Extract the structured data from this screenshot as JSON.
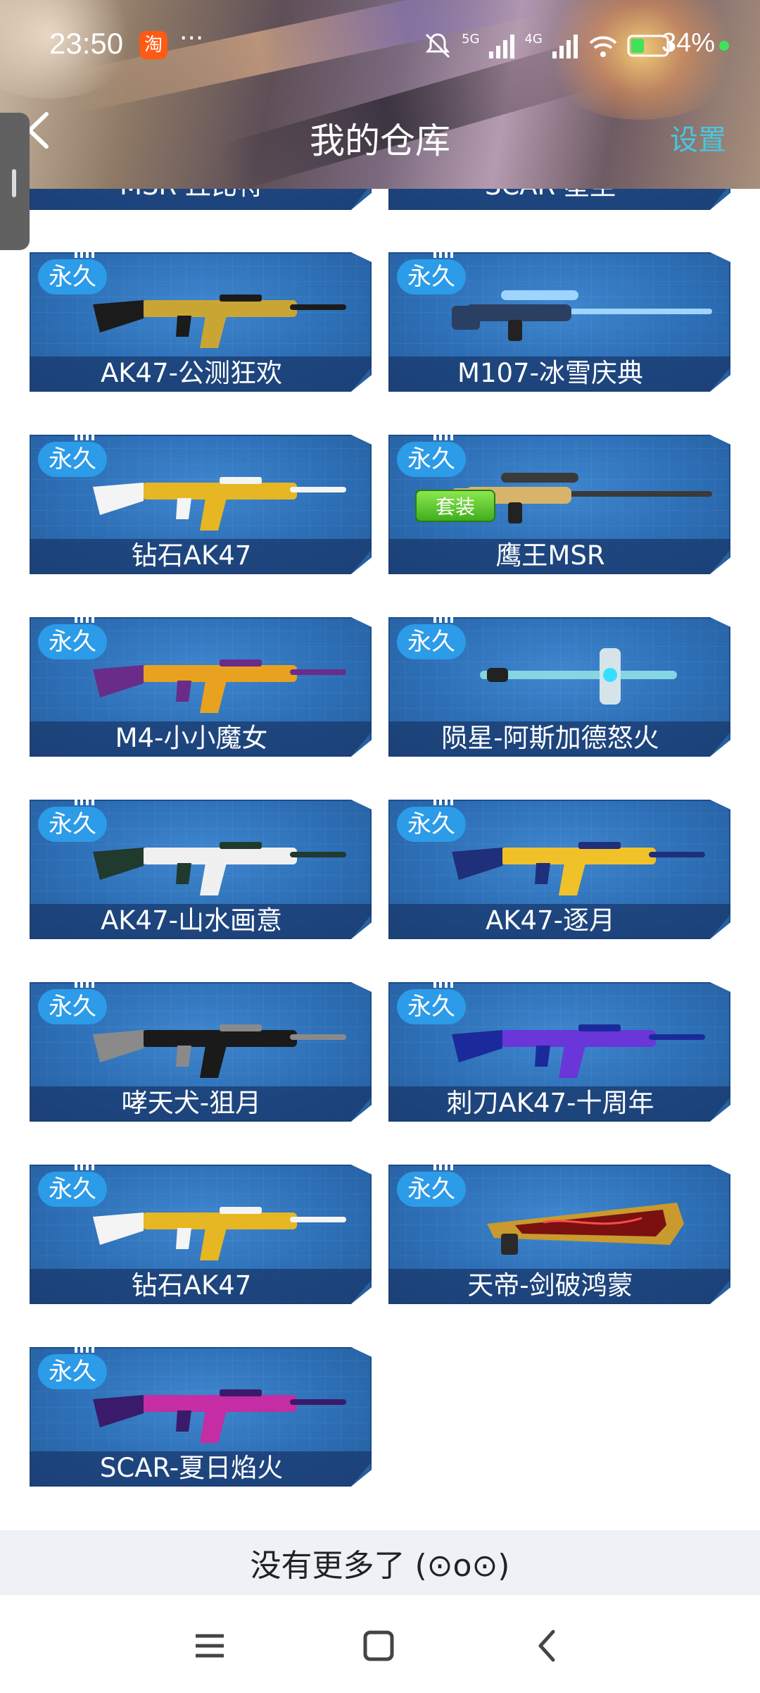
{
  "status_bar": {
    "time": "23:50",
    "app_badge": "淘",
    "more": "···",
    "network_5g": "5G",
    "network_4g": "4G",
    "battery": "34%"
  },
  "header": {
    "title": "我的仓库",
    "settings_label": "设置"
  },
  "top_cut_items": [
    {
      "name": "MSR-丘比特"
    },
    {
      "name": "SCAR-星尘"
    }
  ],
  "items": [
    {
      "name": "AK47-公测狂欢",
      "badge": "永久",
      "weapon_icon": "ak47-rifle-icon",
      "colors": [
        "#c9a634",
        "#1b1b1b"
      ]
    },
    {
      "name": "M107-冰雪庆典",
      "badge": "永久",
      "weapon_icon": "sniper-rifle-icon",
      "colors": [
        "#9fd4ff",
        "#2b3f63"
      ]
    },
    {
      "name": "钻石AK47",
      "badge": "永久",
      "weapon_icon": "ak47-rifle-icon",
      "colors": [
        "#e7b623",
        "#f4f4f4"
      ]
    },
    {
      "name": "鹰王MSR",
      "badge": "永久",
      "extra_badge": "套装",
      "weapon_icon": "sniper-rifle-icon",
      "colors": [
        "#3a3a3a",
        "#d7b46a"
      ]
    },
    {
      "name": "M4-小小魔女",
      "badge": "永久",
      "weapon_icon": "m4-rifle-icon",
      "colors": [
        "#e8a21f",
        "#6a2c89"
      ]
    },
    {
      "name": "陨星-阿斯加德怒火",
      "badge": "永久",
      "weapon_icon": "hammer-icon",
      "colors": [
        "#d6e4ea",
        "#35c9d9"
      ]
    },
    {
      "name": "AK47-山水画意",
      "badge": "永久",
      "weapon_icon": "ak47-rifle-icon",
      "colors": [
        "#f0f0f0",
        "#203a2e"
      ]
    },
    {
      "name": "AK47-逐月",
      "badge": "永久",
      "weapon_icon": "ak47-rifle-icon",
      "colors": [
        "#f1c12a",
        "#1f2f7a"
      ]
    },
    {
      "name": "哮天犬-狙月",
      "badge": "永久",
      "weapon_icon": "assault-rifle-icon",
      "colors": [
        "#1a1a1a",
        "#8a8a8a"
      ]
    },
    {
      "name": "刺刀AK47-十周年",
      "badge": "永久",
      "weapon_icon": "ak47-rifle-icon",
      "colors": [
        "#6a35d9",
        "#1a2a9a"
      ]
    },
    {
      "name": "钻石AK47",
      "badge": "永久",
      "weapon_icon": "ak47-rifle-icon",
      "colors": [
        "#e7b623",
        "#f4f4f4"
      ]
    },
    {
      "name": "天帝-剑破鸿蒙",
      "badge": "永久",
      "weapon_icon": "launcher-icon",
      "colors": [
        "#c99a2e",
        "#7a1010"
      ]
    },
    {
      "name": "SCAR-夏日焰火",
      "badge": "永久",
      "weapon_icon": "scar-rifle-icon",
      "colors": [
        "#c42da3",
        "#3a1a6a"
      ]
    }
  ],
  "footer": {
    "no_more_text": "没有更多了 (⊙o⊙)"
  },
  "system_nav": {
    "menu_icon": "menu-icon",
    "home_icon": "home-icon",
    "back_icon": "back-icon"
  }
}
